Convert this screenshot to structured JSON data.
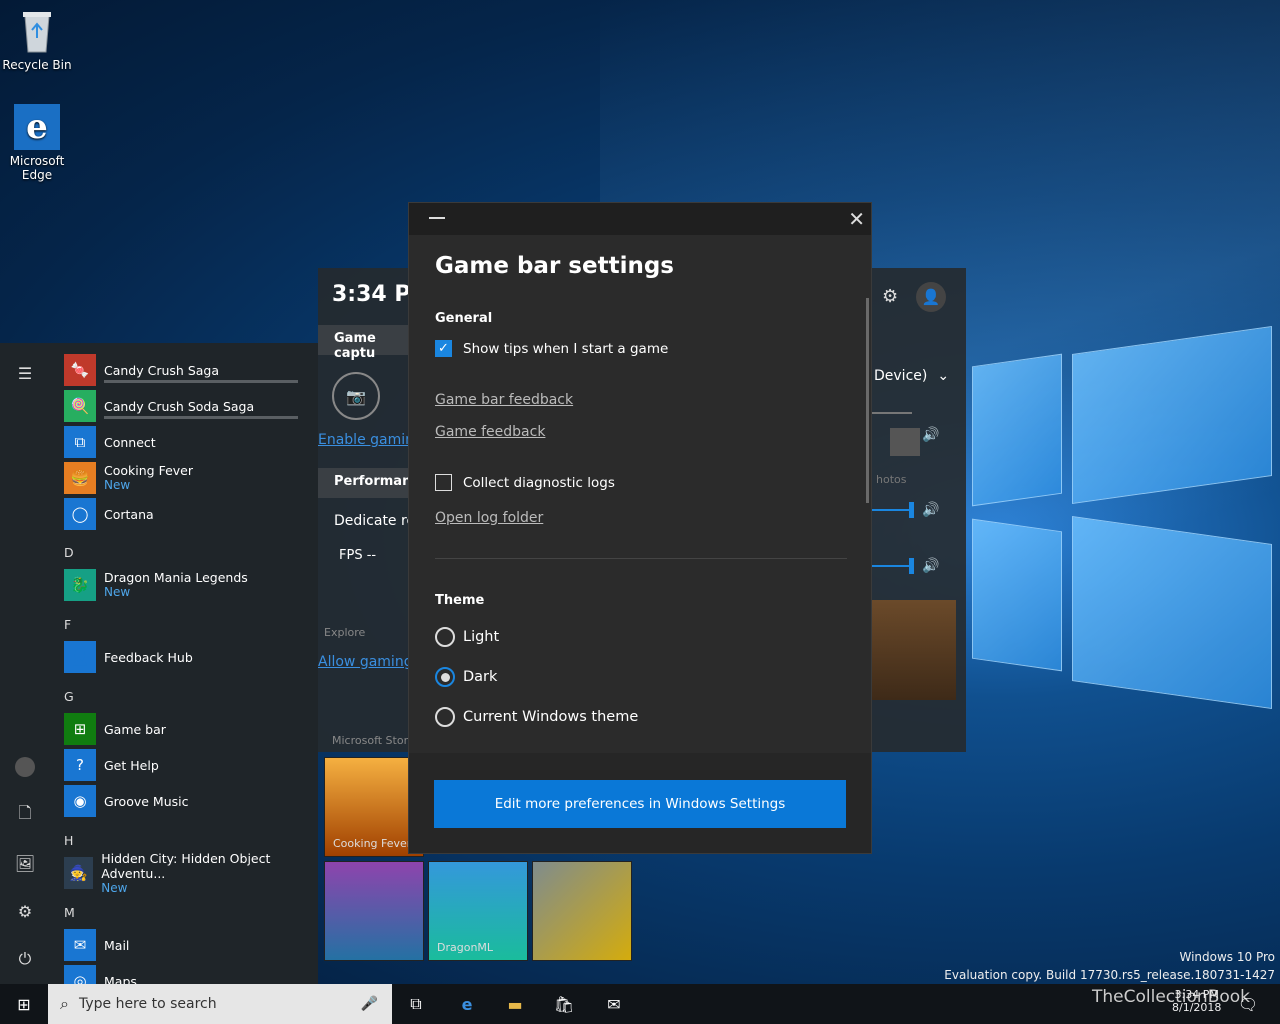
{
  "desktop": {
    "recycle_bin": "Recycle Bin",
    "edge_line1": "Microsoft",
    "edge_line2": "Edge"
  },
  "start_menu": {
    "apps": [
      {
        "name": "Candy Crush Saga",
        "color": "#c0392b",
        "icon": "candy"
      },
      {
        "name": "Candy Crush Soda Saga",
        "color": "#27ae60",
        "icon": "candy-soda"
      },
      {
        "name": "Connect",
        "color": "#1976d2",
        "icon": "connect"
      },
      {
        "name": "Cooking Fever",
        "sub": "New",
        "color": "#e67e22",
        "icon": "burger"
      },
      {
        "name": "Cortana",
        "color": "#1976d2",
        "icon": "cortana"
      },
      {
        "name": "Dragon Mania Legends",
        "sub": "New",
        "color": "#16a085",
        "icon": "dragon"
      },
      {
        "name": "Feedback Hub",
        "color": "#1976d2",
        "icon": "feedback"
      },
      {
        "name": "Game bar",
        "color": "#107c10",
        "icon": "xbox"
      },
      {
        "name": "Get Help",
        "color": "#1976d2",
        "icon": "help"
      },
      {
        "name": "Groove Music",
        "color": "#1976d2",
        "icon": "groove"
      },
      {
        "name": "Hidden City: Hidden Object Adventu...",
        "sub": "New",
        "color": "#2c3e50",
        "icon": "hidden-city"
      },
      {
        "name": "Mail",
        "color": "#1976d2",
        "icon": "mail"
      },
      {
        "name": "Maps",
        "color": "#1976d2",
        "icon": "maps"
      }
    ],
    "letters": {
      "d": "D",
      "f": "F",
      "g": "G",
      "h": "H",
      "m": "M"
    }
  },
  "gamebar": {
    "time": "3:34 PM",
    "game_capture": "Game captu",
    "enable_link": "Enable gamin",
    "performance": "Performanc",
    "dedicate": "Dedicate res",
    "fps": "FPS --",
    "explore": "Explore",
    "allow_link": "Allow gaming",
    "ms_store": "Microsoft Store",
    "device": "Device)",
    "photos": "hotos",
    "cooking_fever": "Cooking Fever",
    "dragonml": "DragonML"
  },
  "dialog": {
    "title": "Game bar settings",
    "general": "General",
    "show_tips": "Show tips when I start a game",
    "show_tips_checked": true,
    "gamebar_feedback": "Game bar feedback",
    "game_feedback": "Game feedback",
    "collect_logs": "Collect diagnostic logs",
    "collect_logs_checked": false,
    "open_log": "Open log folder",
    "theme": "Theme",
    "theme_options": [
      "Light",
      "Dark",
      "Current Windows theme"
    ],
    "theme_selected": "Dark",
    "edit_button": "Edit more preferences in Windows Settings"
  },
  "taskbar": {
    "search_placeholder": "Type here to search",
    "time": "3:34 PM",
    "date": "8/1/2018"
  },
  "watermark": {
    "line1": "Windows 10 Pro",
    "line2": "Evaluation copy. Build 17730.rs5_release.180731-1427",
    "brand": "TheCollectionBook"
  }
}
